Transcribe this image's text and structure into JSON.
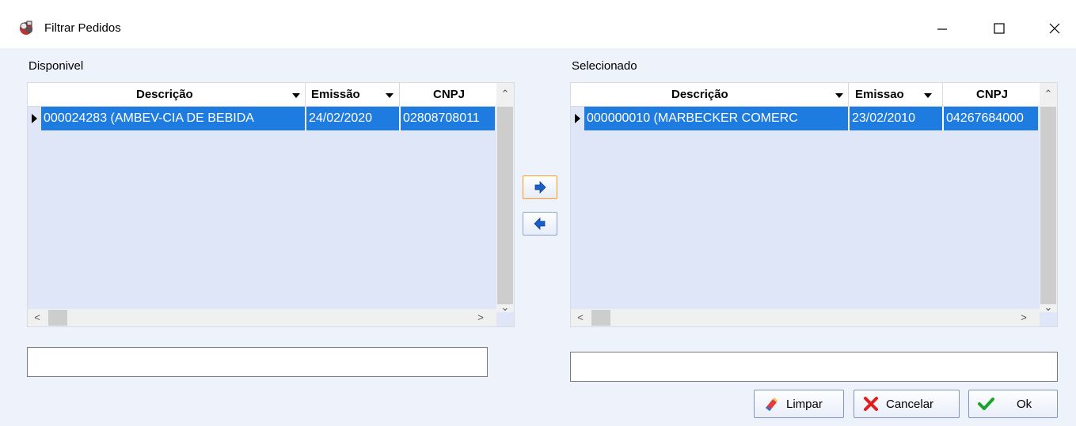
{
  "window": {
    "title": "Filtrar Pedidos",
    "minimize_symbol": "—",
    "maximize_symbol": "☐",
    "close_symbol": "✕"
  },
  "left": {
    "label": "Disponivel",
    "columns": [
      "Descrição",
      "Emissão",
      "CNPJ"
    ],
    "rows": [
      [
        "000024283 (AMBEV-CIA DE BEBIDA",
        "24/02/2020",
        "02808708011"
      ]
    ],
    "filter_value": ""
  },
  "right": {
    "label": "Selecionado",
    "columns": [
      "Descrição",
      "Emissao",
      "CNPJ"
    ],
    "rows": [
      [
        "000000010 (MARBECKER COMERC",
        "23/02/2010",
        "04267684000"
      ]
    ],
    "filter_value": ""
  },
  "buttons": {
    "add_icon": "arrow-right-icon",
    "remove_icon": "arrow-left-icon",
    "limpar": "Limpar",
    "cancelar": "Cancelar",
    "ok": "Ok"
  },
  "colors": {
    "selection": "#1e7be0",
    "grid_background": "#dfe6f8",
    "client_background": "#eef2fb",
    "focus_border": "#ff9d1a"
  }
}
